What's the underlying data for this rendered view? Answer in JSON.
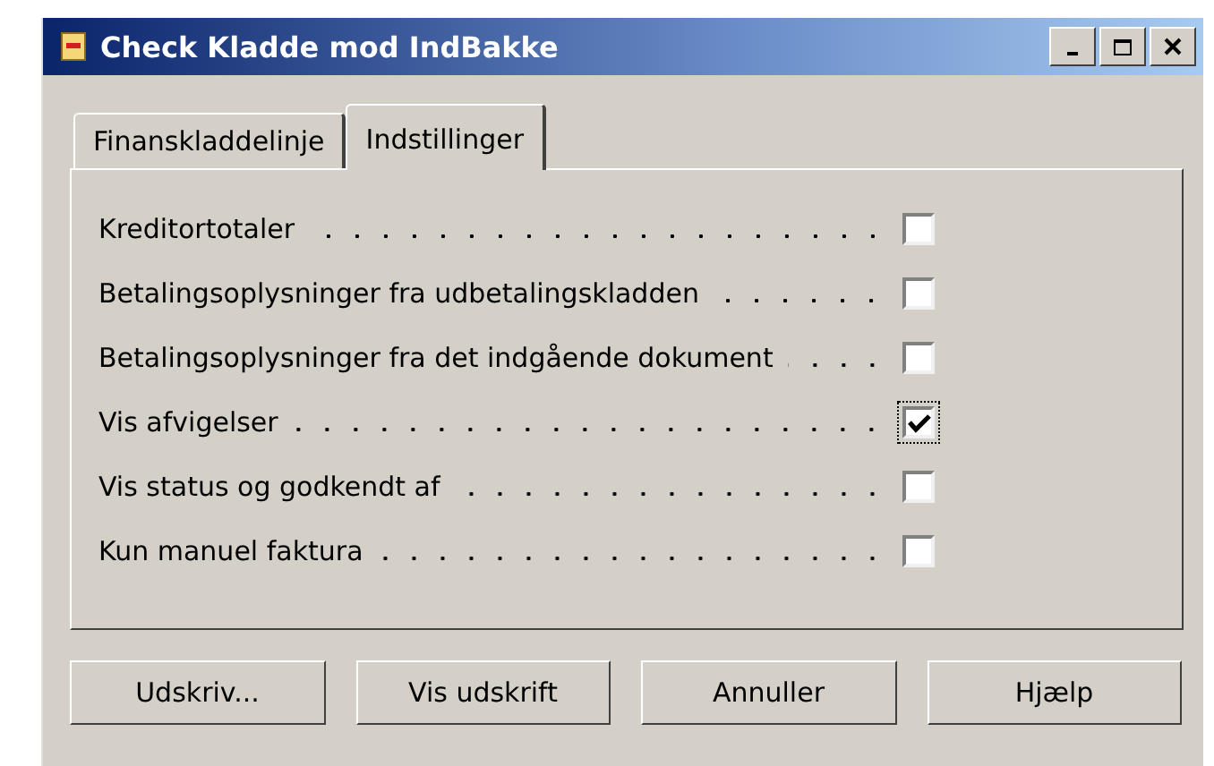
{
  "window": {
    "title": "Check Kladde mod IndBakke"
  },
  "tabs": [
    {
      "label": "Finanskladdelinje",
      "selected": false
    },
    {
      "label": "Indstillinger",
      "selected": true
    }
  ],
  "options": [
    {
      "label": "Kreditortotaler",
      "checked": false,
      "focused": false
    },
    {
      "label": "Betalingsoplysninger fra udbetalingskladden",
      "checked": false,
      "focused": false
    },
    {
      "label": "Betalingsoplysninger fra det indgående dokument",
      "checked": false,
      "focused": false
    },
    {
      "label": "Vis afvigelser",
      "checked": true,
      "focused": true
    },
    {
      "label": "Vis status og godkendt af",
      "checked": false,
      "focused": false
    },
    {
      "label": "Kun manuel faktura",
      "checked": false,
      "focused": false
    }
  ],
  "buttons": [
    "Udskriv...",
    "Vis udskrift",
    "Annuller",
    "Hjælp"
  ]
}
